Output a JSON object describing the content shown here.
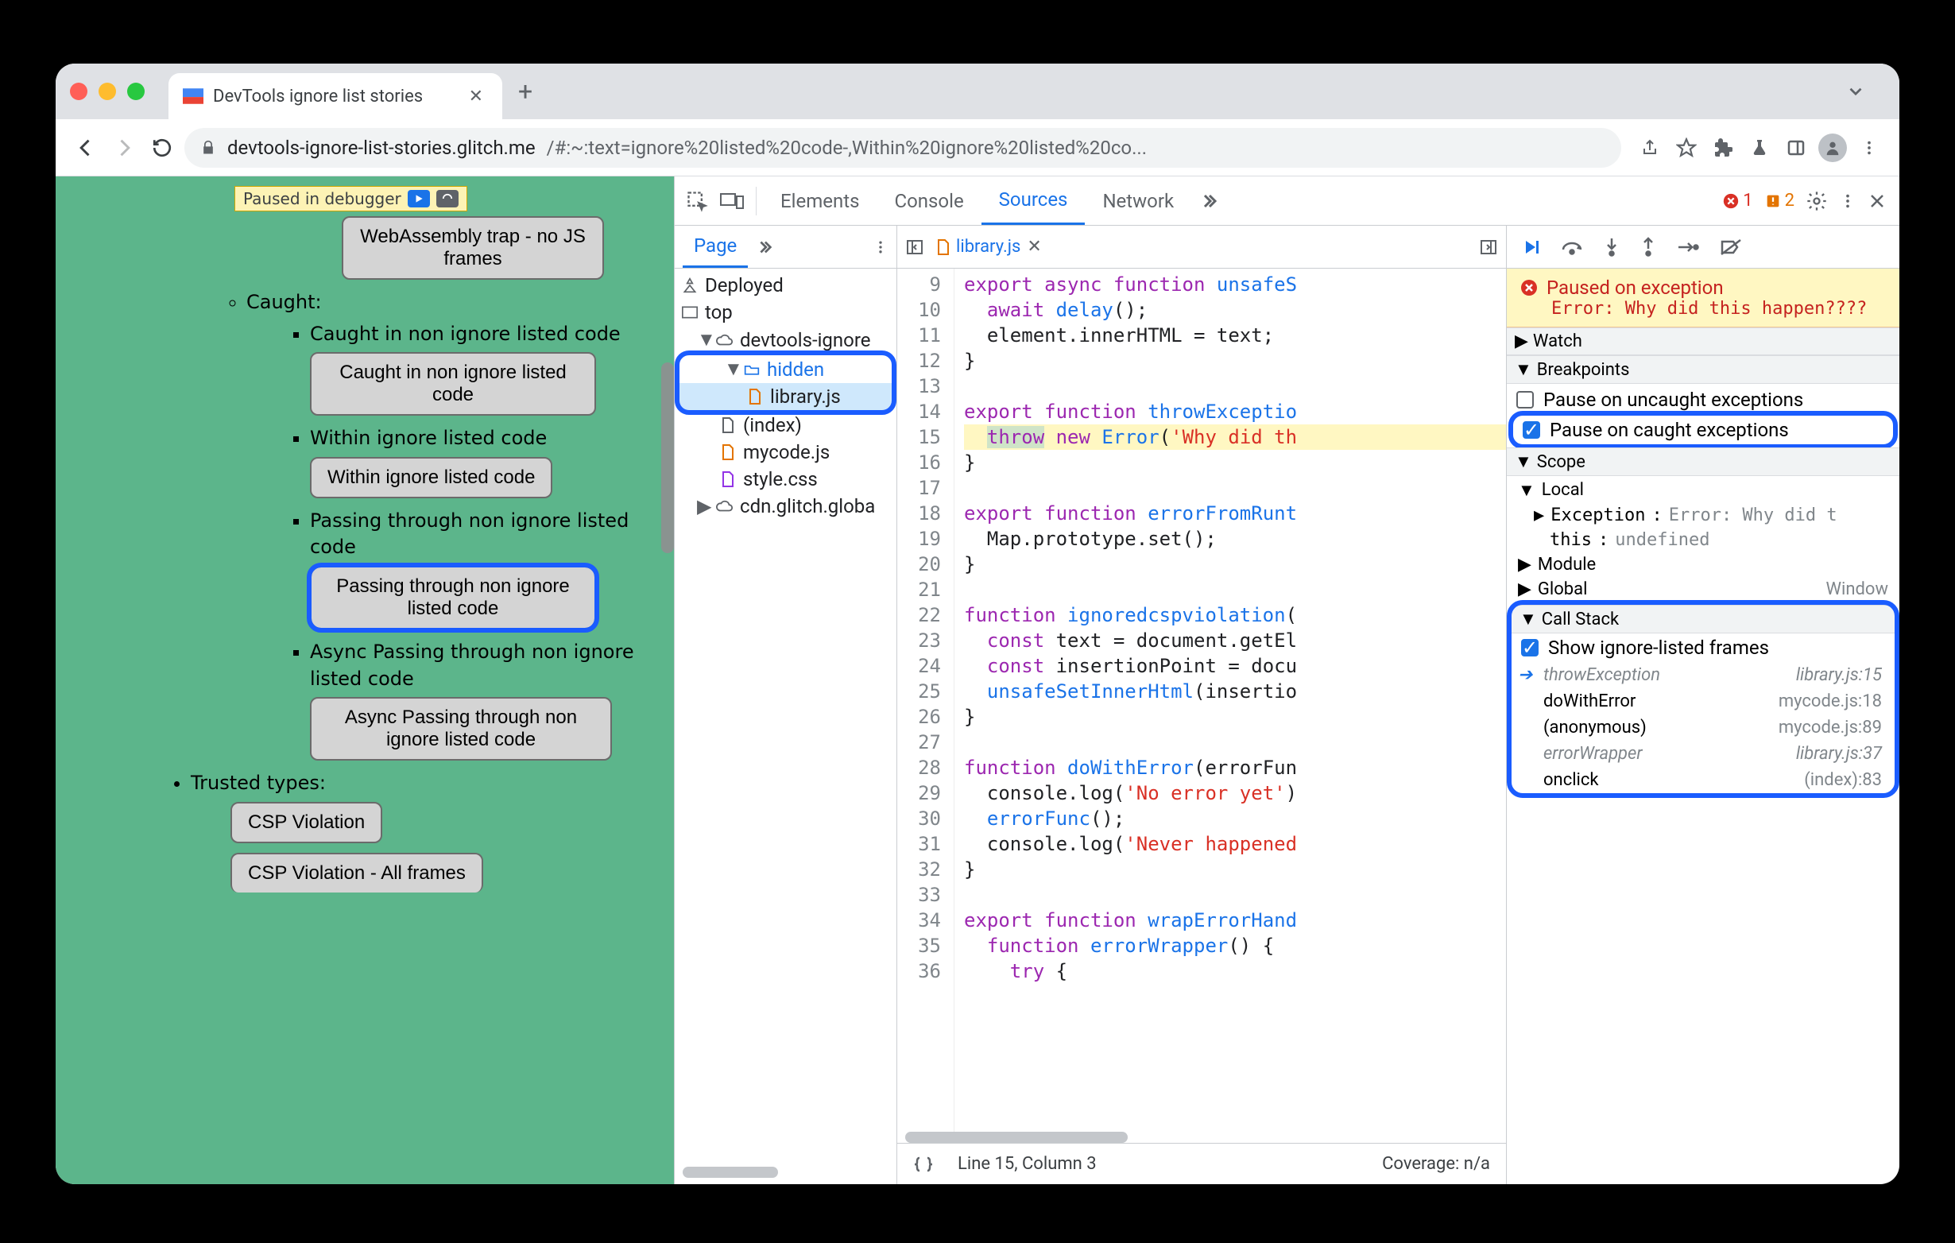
{
  "tab": {
    "title": "DevTools ignore list stories"
  },
  "url": {
    "host": "devtools-ignore-list-stories.glitch.me",
    "path": "/#:~:text=ignore%20listed%20code-,Within%20ignore%20listed%20co..."
  },
  "paused_overlay": "Paused in debugger",
  "page": {
    "trap": "WebAssembly trap - no JS frames",
    "caught_header": "Caught:",
    "li1": "Caught in non ignore listed code",
    "btn1": "Caught in non ignore listed code",
    "li2": "Within ignore listed code",
    "btn2": "Within ignore listed code",
    "li3": "Passing through non ignore listed code",
    "btn3": "Passing through non ignore listed code",
    "li4": "Async Passing through non ignore listed code",
    "btn4": "Async Passing through non ignore listed code",
    "trusted": "Trusted types:",
    "btn5": "CSP Violation",
    "btn6": "CSP Violation - All frames"
  },
  "devtools": {
    "tabs": {
      "elements": "Elements",
      "console": "Console",
      "sources": "Sources",
      "network": "Network"
    },
    "errors": "1",
    "warnings": "2",
    "nav": {
      "page": "Page",
      "deployed": "Deployed",
      "top": "top",
      "origin": "devtools-ignore",
      "hidden": "hidden",
      "library": "library.js",
      "index": "(index)",
      "mycode": "mycode.js",
      "style": "style.css",
      "cdn": "cdn.glitch.globa"
    },
    "editor": {
      "filename": "library.js",
      "lines_start": 9,
      "lines": [
        "export async function unsafeS",
        "  await delay();",
        "  element.innerHTML = text;",
        "}",
        "",
        "export function throwExceptio",
        "  throw new Error('Why did th",
        "}",
        "",
        "export function errorFromRunt",
        "  Map.prototype.set();",
        "}",
        "",
        "function ignoredcspviolation(",
        "  const text = document.getEl",
        "  const insertionPoint = docu",
        "  unsafeSetInnerHtml(insertio",
        "}",
        "",
        "function doWithError(errorFun",
        "  console.log('No error yet')",
        "  errorFunc();",
        "  console.log('Never happened",
        "}",
        "",
        "export function wrapErrorHand",
        "  function errorWrapper() {",
        "    try {"
      ],
      "status_line": "Line 15, Column 3",
      "coverage": "Coverage: n/a"
    },
    "debugger": {
      "paused_title": "Paused on exception",
      "paused_err": "Error: Why did this happen????",
      "watch": "Watch",
      "breakpoints": "Breakpoints",
      "bp_uncaught": "Pause on uncaught exceptions",
      "bp_caught": "Pause on caught exceptions",
      "scope": "Scope",
      "scope_local": "Local",
      "scope_exc_k": "Exception",
      "scope_exc_v": "Error: Why did t",
      "scope_this_k": "this",
      "scope_this_v": "undefined",
      "scope_module": "Module",
      "scope_global": "Global",
      "scope_global_v": "Window",
      "callstack": "Call Stack",
      "cs_show": "Show ignore-listed frames",
      "frames": [
        {
          "name": "throwException",
          "loc": "library.js:15",
          "ignored": true,
          "current": true
        },
        {
          "name": "doWithError",
          "loc": "mycode.js:18",
          "ignored": false
        },
        {
          "name": "(anonymous)",
          "loc": "mycode.js:89",
          "ignored": false
        },
        {
          "name": "errorWrapper",
          "loc": "library.js:37",
          "ignored": true
        },
        {
          "name": "onclick",
          "loc": "(index):83",
          "ignored": false
        }
      ]
    }
  }
}
